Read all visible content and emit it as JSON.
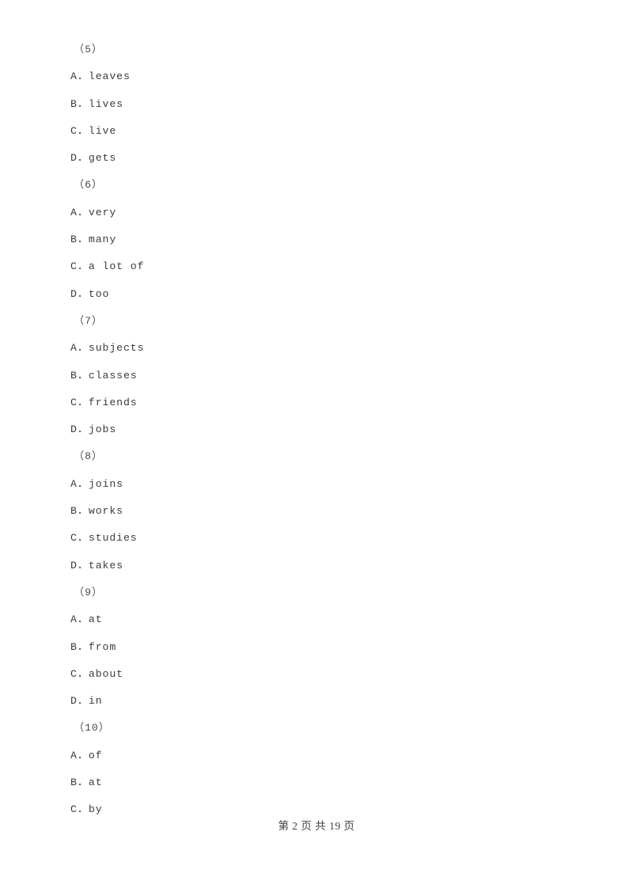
{
  "document": {
    "type": "exam-paper",
    "background_color": "#ffffff",
    "text_color": "#3b3b3b",
    "option_separator": "．"
  },
  "blocks": [
    {
      "number_label": "（5）",
      "options": [
        {
          "letter": "A",
          "text": "leaves"
        },
        {
          "letter": "B",
          "text": "lives"
        },
        {
          "letter": "C",
          "text": "live"
        },
        {
          "letter": "D",
          "text": "gets"
        }
      ]
    },
    {
      "number_label": "（6）",
      "options": [
        {
          "letter": "A",
          "text": "very"
        },
        {
          "letter": "B",
          "text": "many"
        },
        {
          "letter": "C",
          "text": "a lot of"
        },
        {
          "letter": "D",
          "text": "too"
        }
      ]
    },
    {
      "number_label": "（7）",
      "options": [
        {
          "letter": "A",
          "text": "subjects"
        },
        {
          "letter": "B",
          "text": "classes"
        },
        {
          "letter": "C",
          "text": "friends"
        },
        {
          "letter": "D",
          "text": "jobs"
        }
      ]
    },
    {
      "number_label": "（8）",
      "options": [
        {
          "letter": "A",
          "text": "joins"
        },
        {
          "letter": "B",
          "text": "works"
        },
        {
          "letter": "C",
          "text": "studies"
        },
        {
          "letter": "D",
          "text": "takes"
        }
      ]
    },
    {
      "number_label": "（9）",
      "options": [
        {
          "letter": "A",
          "text": "at"
        },
        {
          "letter": "B",
          "text": "from"
        },
        {
          "letter": "C",
          "text": "about"
        },
        {
          "letter": "D",
          "text": "in"
        }
      ]
    },
    {
      "number_label": "（10）",
      "options": [
        {
          "letter": "A",
          "text": "of"
        },
        {
          "letter": "B",
          "text": "at"
        },
        {
          "letter": "C",
          "text": "by"
        }
      ]
    }
  ],
  "footer": {
    "text": "第 2 页 共 19 页",
    "current_page": "2",
    "total_pages": "19"
  }
}
